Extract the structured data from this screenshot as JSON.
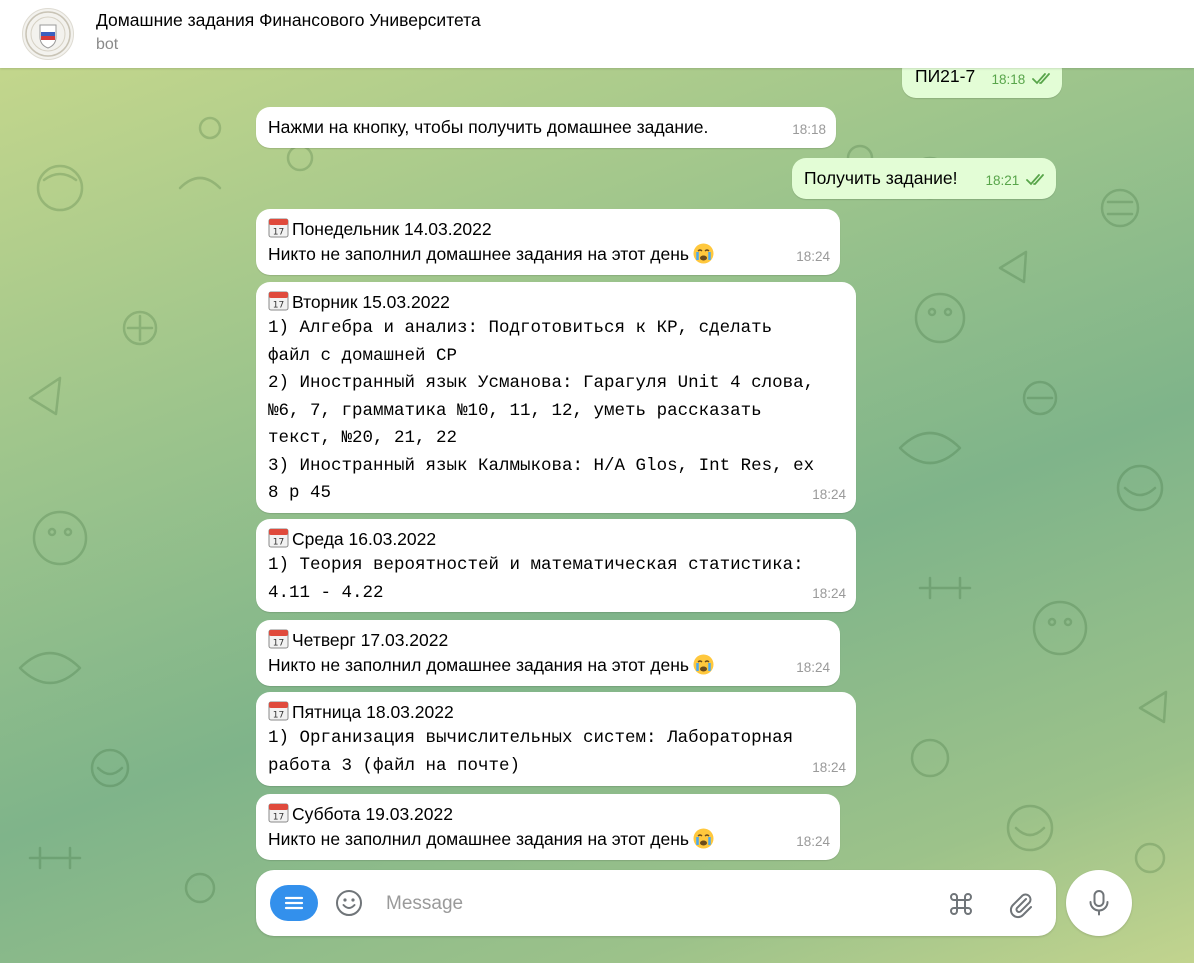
{
  "header": {
    "title": "Домашние задания Финансового Университета",
    "subtitle": "bot"
  },
  "messages": [
    {
      "direction": "out",
      "text": "ПИ21-7",
      "time": "18:18",
      "read": true
    },
    {
      "direction": "in",
      "text": "Нажми на кнопку, чтобы получить домашнее задание.",
      "time": "18:18"
    },
    {
      "direction": "out",
      "text": "Получить задание!",
      "time": "18:21",
      "read": true
    },
    {
      "direction": "in",
      "heading": "Понедельник 14.03.2022",
      "text": "Никто не заполнил домашнее задания на этот день",
      "emoji": "crying-face-emoji",
      "time": "18:24"
    },
    {
      "direction": "in",
      "heading": "Вторник 15.03.2022",
      "lines": [
        "1) Алгебра и анализ: Подготовиться к КР, сделать",
        "файл с домашней СР",
        "2) Иностранный язык Усманова: Гарагуля Unit 4 слова,",
        "№6, 7, грамматика №10, 11, 12, уметь рассказать",
        "текст, №20, 21, 22",
        "3) Иностранный язык Калмыкова: H/A Glos, Int Res, ex",
        "8 p 45"
      ],
      "time": "18:24"
    },
    {
      "direction": "in",
      "heading": "Среда 16.03.2022",
      "lines": [
        "1) Теория вероятностей и математическая статистика:",
        "4.11 - 4.22"
      ],
      "time": "18:24"
    },
    {
      "direction": "in",
      "heading": "Четверг 17.03.2022",
      "text": "Никто не заполнил домашнее задания на этот день",
      "emoji": "crying-face-emoji",
      "time": "18:24"
    },
    {
      "direction": "in",
      "heading": "Пятница 18.03.2022",
      "lines": [
        "1) Организация вычислительных систем: Лабораторная",
        "работа 3 (файл на почте)"
      ],
      "time": "18:24"
    },
    {
      "direction": "in",
      "heading": "Суббота 19.03.2022",
      "text": "Никто не заполнил домашнее задания на этот день",
      "emoji": "crying-face-emoji",
      "time": "18:24"
    }
  ],
  "composer": {
    "placeholder": "Message"
  },
  "icons": {
    "heading": "calendar-icon",
    "emoji": "crying-face-emoji"
  },
  "colors": {
    "accent": "#3390ec",
    "incoming_bubble": "#ffffff",
    "outgoing_bubble": "#e3fdd6",
    "outgoing_meta": "#58a54a",
    "background_start": "#c9d98c",
    "background_mid": "#7fb48a"
  }
}
